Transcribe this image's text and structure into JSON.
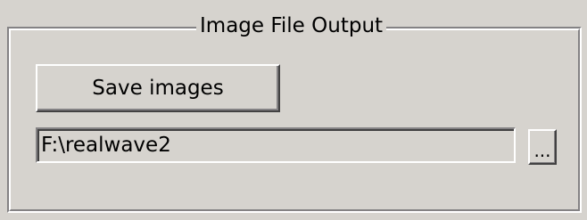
{
  "group": {
    "title": "Image File Output"
  },
  "save_button": {
    "label": "Save images"
  },
  "path_field": {
    "value": "F:\\realwave2"
  },
  "browse_button": {
    "label": "..."
  },
  "colors": {
    "face": "#d6d3ce",
    "highlight": "#ffffff",
    "shadow": "#848284",
    "dark_shadow": "#424142"
  }
}
